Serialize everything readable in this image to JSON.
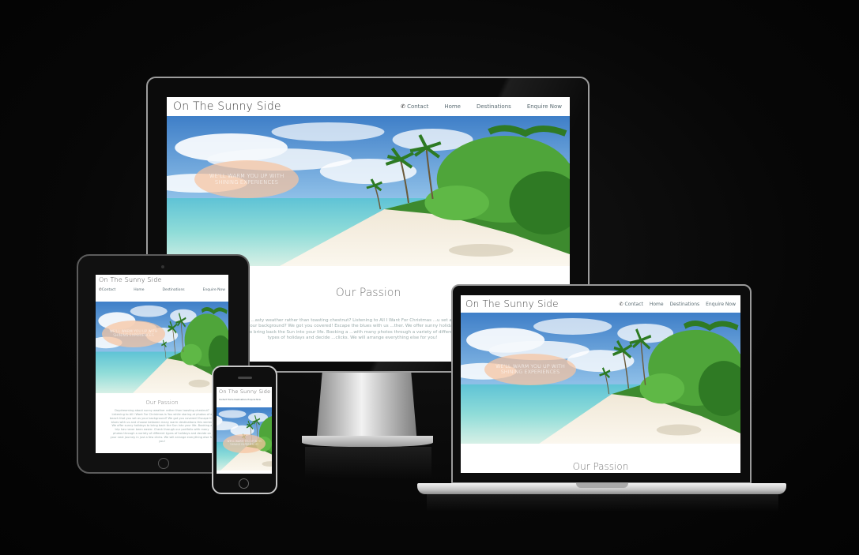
{
  "site": {
    "brand": "On The Sunny Side",
    "nav": {
      "contact": "Contact",
      "home": "Home",
      "destinations": "Destinations",
      "enquire": "Enquire Now"
    },
    "tagline_line1": "WE'LL WARM YOU UP WITH",
    "tagline_line2": "SHINING EXPERIENCES",
    "passion_title": "Our Passion",
    "passion_text_desktop": "...asty weather rather than toasting chestnut? Listening to All I Want For Christmas ...u set as your background? We got you covered! Escape the blues with us ...ther. We offer sunny holidays to bring back the Sun into your life. Booking a ...with many photos through a variety of different types of holidays and decide ...clicks. We will arrange everything else for you!",
    "passion_text_tablet": "Daydreaming about sunny weather rather than toasting chestnut? Listening to All I Want For Christmas is You while staring at photos of a beach that you set as your background? We got you covered! Escape the blues with us and choose between many warm destinations this winter. We offer sunny holidays to bring back the Sun into your life. Booking a trip has never been easier. Check through our portfolio with many photos through a variety of different types of holidays and decide on your next journey in just a few clicks. We will arrange everything else for you!",
    "mobile_nav_text": "Contact  Home  Destinations  Enquire Now"
  },
  "colors": {
    "background": "#060606",
    "tagline_bubble": "#f6c4a0",
    "nav_text": "#5a6b72",
    "brand_text": "#444444"
  },
  "icons": {
    "contact": "phone-icon"
  }
}
